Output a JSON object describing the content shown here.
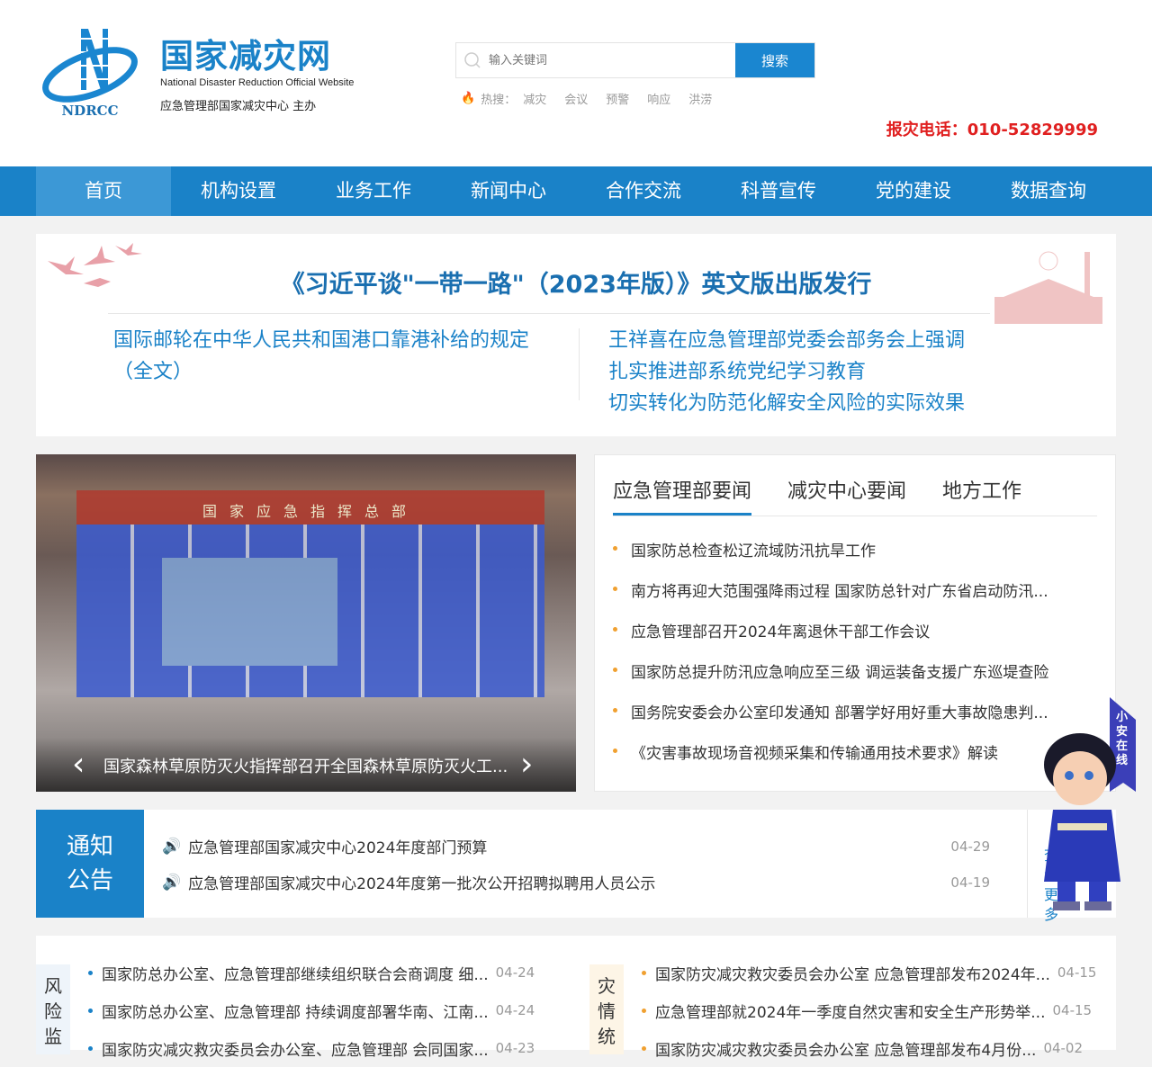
{
  "header": {
    "logo_text": "NDRCC",
    "title": "国家减灾网",
    "subtitle_en": "National Disaster Reduction Official Website",
    "host": "应急管理部国家减灾中心 主办",
    "search_placeholder": "输入关键词",
    "search_button": "搜索",
    "hot_label": "热搜：",
    "hot_keywords": [
      "减灾",
      "会议",
      "预警",
      "响应",
      "洪涝"
    ],
    "hotline": "报灾电话：010-52829999"
  },
  "nav": [
    "首页",
    "机构设置",
    "业务工作",
    "新闻中心",
    "合作交流",
    "科普宣传",
    "党的建设",
    "数据查询"
  ],
  "banner": {
    "headline": "《习近平谈\"一带一路\"（2023年版）》英文版出版发行",
    "left_link": "国际邮轮在中华人民共和国港口靠港补给的规定（全文）",
    "right_lines": [
      "王祥喜在应急管理部党委会部务会上强调",
      "扎实推进部系统党纪学习教育",
      "切实转化为防范化解安全风险的实际效果"
    ]
  },
  "slider": {
    "caption": "国家森林草原防灭火指挥部召开全国森林草原防灭火工...",
    "screen_title": "国家应急指挥总部"
  },
  "news": {
    "tabs": [
      "应急管理部要闻",
      "减灾中心要闻",
      "地方工作"
    ],
    "items": [
      "国家防总检查松辽流域防汛抗旱工作",
      "南方将再迎大范围强降雨过程 国家防总针对广东省启动防汛...",
      "应急管理部召开2024年离退休干部工作会议",
      "国家防总提升防汛应急响应至三级 调运装备支援广东巡堤查险",
      "国务院安委会办公室印发通知 部署学好用好重大事故隐患判...",
      "《灾害事故现场音视频采集和传输通用技术要求》解读"
    ]
  },
  "notice": {
    "label_1": "通知",
    "label_2": "公告",
    "items": [
      {
        "title": "应急管理部国家减灾中心2024年度部门预算",
        "date": "04-29"
      },
      {
        "title": "应急管理部国家减灾中心2024年度第一批次公开招聘拟聘用人员公示",
        "date": "04-19"
      }
    ],
    "more": "查看更多"
  },
  "risk": {
    "label": "风险监",
    "items": [
      {
        "title": "国家防总办公室、应急管理部继续组织联合会商调度 细...",
        "date": "04-24"
      },
      {
        "title": "国家防总办公室、应急管理部 持续调度部署华南、江南...",
        "date": "04-24"
      },
      {
        "title": "国家防灾减灾救灾委员会办公室、应急管理部 会同国家...",
        "date": "04-23"
      }
    ]
  },
  "disaster": {
    "label": "灾情统",
    "items": [
      {
        "title": "国家防灾减灾救灾委员会办公室 应急管理部发布2024年...",
        "date": "04-15"
      },
      {
        "title": "应急管理部就2024年一季度自然灾害和安全生产形势举...",
        "date": "04-15"
      },
      {
        "title": "国家防灾减灾救灾委员会办公室 应急管理部发布4月份...",
        "date": "04-02"
      }
    ]
  },
  "mascot": {
    "ribbon": "小安在线"
  }
}
